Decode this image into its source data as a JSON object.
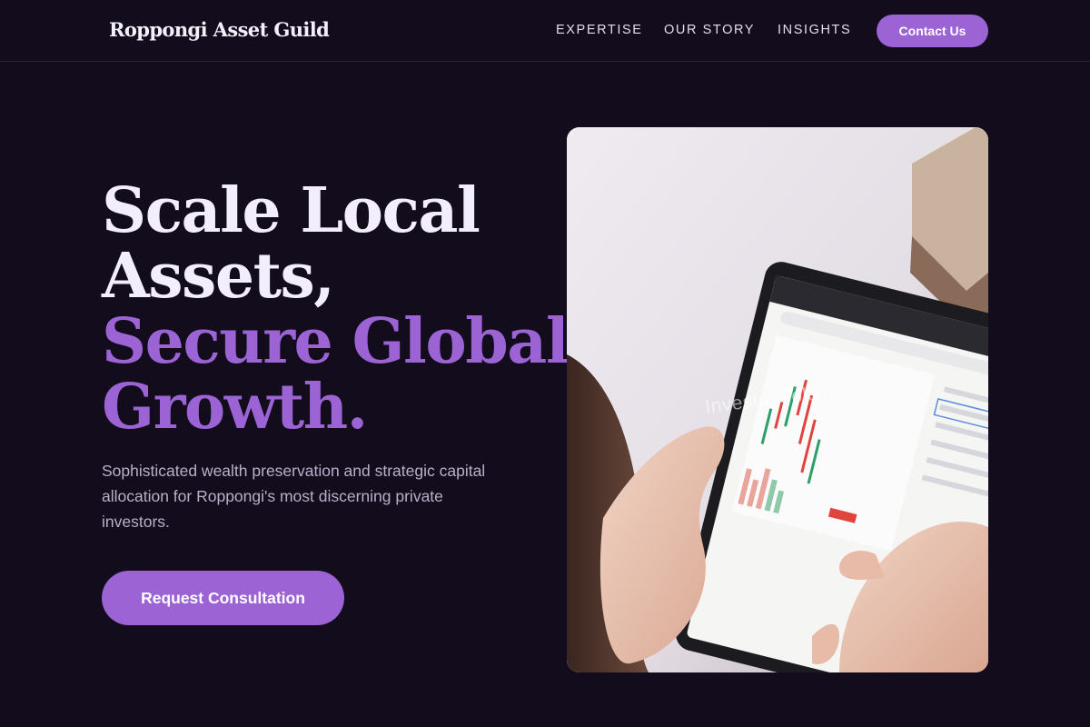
{
  "brand": {
    "name": "Roppongi Asset Guild"
  },
  "nav": {
    "links": [
      "EXPERTISE",
      "OUR STORY",
      "INSIGHTS"
    ],
    "contact_label": "Contact Us"
  },
  "hero": {
    "headline_lines": [
      "Scale Local",
      "Assets,",
      "Secure Global",
      "Growth."
    ],
    "subcopy": "Sophisticated wealth preservation and strategic capital allocation for Roppongi's most discerning private investors.",
    "cta_label": "Request Consultation",
    "image": {
      "description_icon": "tablet-trading-photo",
      "watermark": "Investor Tokyo"
    }
  },
  "colors": {
    "background": "#120c1d",
    "accent": "#9b63d3",
    "text_light": "#f3eefc",
    "text_muted": "#b9b0c8"
  }
}
